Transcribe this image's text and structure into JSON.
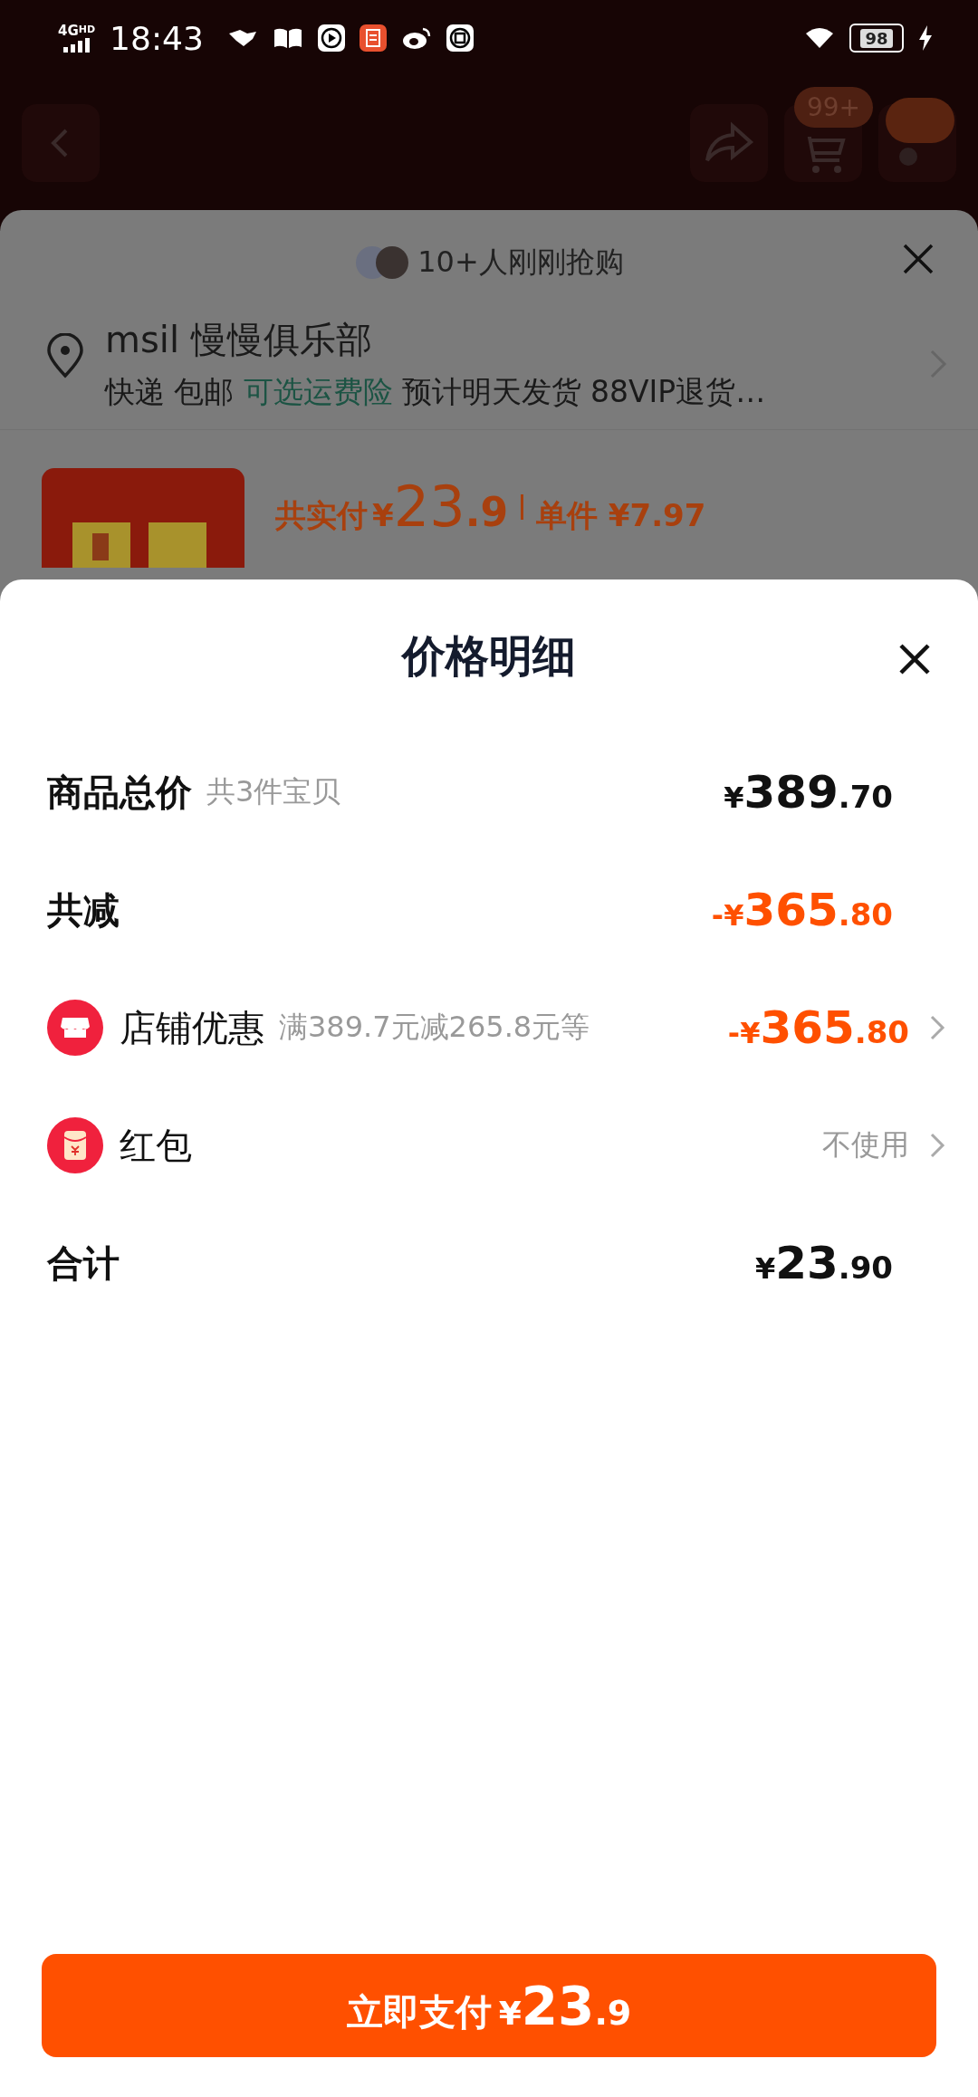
{
  "status_bar": {
    "network": "4G",
    "network_sub": "HD",
    "time": "18:43",
    "battery": "98"
  },
  "top_nav": {
    "cart_badge": "99+"
  },
  "order_sheet": {
    "social_proof": "10+人刚刚抢购",
    "address": "msil 慢慢俱乐部",
    "shipping": [
      {
        "kind": "plain",
        "text": "快递 包邮"
      },
      {
        "kind": "link",
        "text": "可选运费险"
      },
      {
        "kind": "plain",
        "text": "预计明天发货 88VIP退货…"
      }
    ],
    "product": {
      "total_label": "共实付",
      "currency": "¥",
      "whole": "23",
      "fraction": ".9",
      "unit_label": "单件",
      "unit_price": "¥7.97"
    }
  },
  "price_detail": {
    "title": "价格明细",
    "rows": [
      {
        "kind": "plain",
        "label": "商品总价",
        "note": "共3件宝贝",
        "discount": false,
        "price": {
          "currency": "¥",
          "whole": "389",
          "fraction": ".70"
        }
      },
      {
        "kind": "plain",
        "label": "共减",
        "discount": true,
        "price": {
          "currency": "-¥",
          "whole": "365",
          "fraction": ".80"
        }
      },
      {
        "kind": "store",
        "label": "店铺优惠",
        "note": "满389.7元减265.8元等",
        "discount": true,
        "price": {
          "currency": "-¥",
          "whole": "365",
          "fraction": ".80"
        }
      },
      {
        "kind": "red_packet",
        "label": "红包",
        "value": "不使用"
      },
      {
        "kind": "plain",
        "label": "合计",
        "discount": false,
        "price": {
          "currency": "¥",
          "whole": "23",
          "fraction": ".90"
        }
      }
    ],
    "pay_button": {
      "label": "立即支付",
      "currency": "¥",
      "whole": "23",
      "fraction": ".9"
    }
  }
}
